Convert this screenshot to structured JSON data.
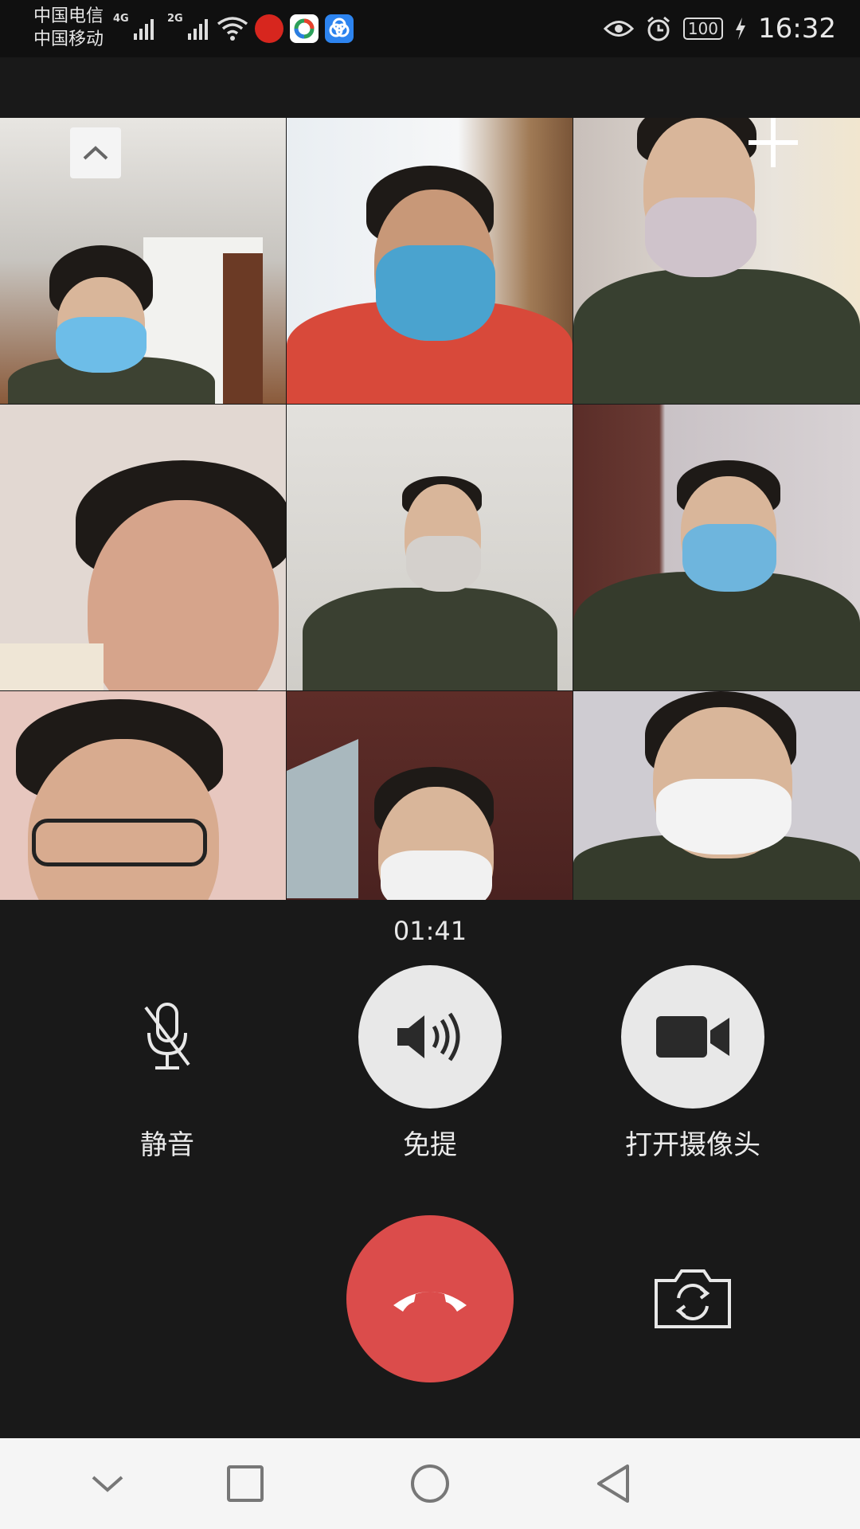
{
  "status_bar": {
    "carrier_1": "中国电信",
    "carrier_2": "中国移动",
    "network_1": "4G",
    "network_2": "2G",
    "battery": "100",
    "time": "16:32",
    "icons": [
      "signal-icon",
      "signal-icon",
      "wifi-icon",
      "xuexi-app-icon",
      "browser-app-icon",
      "tencent-app-icon",
      "eye-icon",
      "alarm-icon",
      "battery-icon",
      "charging-icon"
    ]
  },
  "call": {
    "participants": 9,
    "timer": "01:41",
    "controls": [
      {
        "label": "静音",
        "icon": "mic-muted-icon"
      },
      {
        "label": "免提",
        "icon": "speaker-icon"
      },
      {
        "label": "打开摄像头",
        "icon": "camera-icon"
      }
    ],
    "hangup_icon": "hangup-phone-icon",
    "switch_camera_icon": "switch-camera-icon"
  },
  "nav_bar": {
    "icons": [
      "chevron-down-icon",
      "recents-square-icon",
      "home-circle-icon",
      "back-triangle-icon"
    ]
  },
  "colors": {
    "background": "#191919",
    "hangup": "#db4c4b",
    "control_fill": "#e8e8e8",
    "nav_bg": "#f5f5f5"
  }
}
